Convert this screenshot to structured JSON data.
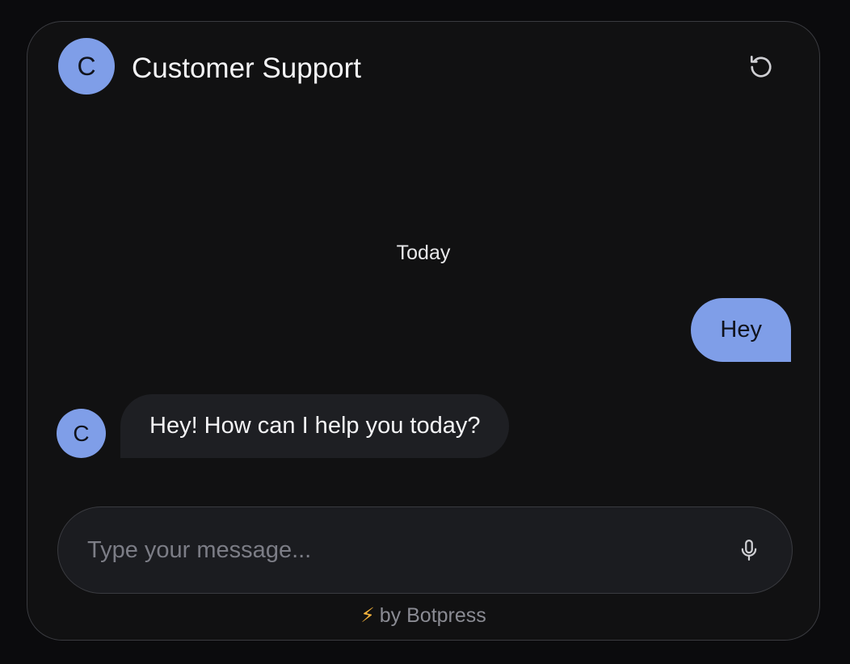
{
  "header": {
    "avatar_letter": "C",
    "title": "Customer Support",
    "restart_icon": "restart-icon"
  },
  "conversation": {
    "date_divider": "Today",
    "messages": [
      {
        "sender": "user",
        "text": "Hey"
      },
      {
        "sender": "bot",
        "avatar_letter": "C",
        "text": "Hey! How can I help you today?"
      }
    ]
  },
  "composer": {
    "placeholder": "Type your message...",
    "value": "",
    "mic_icon": "microphone-icon"
  },
  "footer": {
    "bolt_icon": "⚡",
    "label": "by Botpress"
  },
  "colors": {
    "accent": "#7f9ee8",
    "background": "#111112",
    "bot_bubble": "#1e1f23",
    "border": "#3a3b40"
  }
}
